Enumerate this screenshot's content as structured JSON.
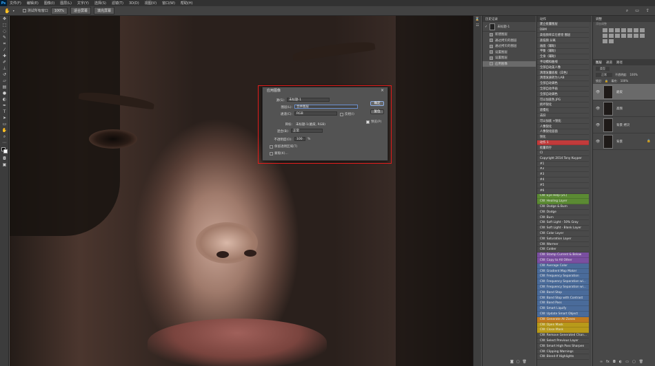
{
  "menubar": {
    "logo": "Ps",
    "items": [
      "文件(F)",
      "编辑(E)",
      "图像(I)",
      "图层(L)",
      "文字(Y)",
      "选择(S)",
      "滤镜(T)",
      "3D(D)",
      "视图(V)",
      "窗口(W)",
      "帮助(H)"
    ]
  },
  "options": {
    "sample_all": "测试所有窗口",
    "zoom": "100%",
    "fit_screen": "适合屏幕",
    "fill_screen": "填充屏幕"
  },
  "dialog": {
    "title": "应用图像",
    "source_label": "源(S):",
    "source_value": "未标题-1",
    "layer_label": "图层(L):",
    "layer_value": "合并图层",
    "channel_label": "通道(C):",
    "channel_value": "RGB",
    "invert_label": "反相(I)",
    "target_label": "目标:",
    "target_value": "未标题-1(磨皮, RGB)",
    "blend_label": "混合(B):",
    "blend_value": "正常",
    "opacity_label": "不透明度(O):",
    "opacity_value": "100",
    "opacity_unit": "%",
    "preserve_label": "保留透明区域(T)",
    "mask_label": "蒙版(K)...",
    "ok": "确定",
    "reset": "复位",
    "preview": "预览(P)"
  },
  "history": {
    "title": "历史记录",
    "snapshot": "未标题-1",
    "items": [
      "新建图层",
      "通过拷贝的图层",
      "通过拷贝的图层",
      "设置图层",
      "设置图层",
      "应用图像"
    ]
  },
  "actions": {
    "title": "动作",
    "items": [
      {
        "label": "建立批量图层",
        "color": "#4a4a4a"
      },
      {
        "label": "DBM",
        "color": "#4a4a4a"
      },
      {
        "label": "高低频率实在感觉 图层",
        "color": "#4a4a4a"
      },
      {
        "label": "高低频 分离",
        "color": "#4a4a4a"
      },
      {
        "label": "画面（辅助）",
        "color": "#4a4a4a"
      },
      {
        "label": "平衡（辅助）",
        "color": "#4a4a4a"
      },
      {
        "label": "全身（辅助）",
        "color": "#4a4a4a"
      },
      {
        "label": "手动模拟曲线",
        "color": "#4a4a4a"
      },
      {
        "label": "全部自动美人像",
        "color": "#4a4a4a"
      },
      {
        "label": "清理发量底板（白色）",
        "color": "#4a4a4a"
      },
      {
        "label": "清理发质转为 LAB",
        "color": "#4a4a4a"
      },
      {
        "label": "全部自动调色",
        "color": "#4a4a4a"
      },
      {
        "label": "全部自动手画",
        "color": "#4a4a4a"
      },
      {
        "label": "全部自动调色",
        "color": "#4a4a4a"
      },
      {
        "label": "可以加底色 JPG",
        "color": "#4a4a4a"
      },
      {
        "label": "损坏锐化",
        "color": "#4a4a4a"
      },
      {
        "label": "遮慢化",
        "color": "#4a4a4a"
      },
      {
        "label": "去旧",
        "color": "#4a4a4a"
      },
      {
        "label": "可以加底 +锐化",
        "color": "#4a4a4a"
      },
      {
        "label": "人像锐化",
        "color": "#4a4a4a"
      },
      {
        "label": "人像锐化层面",
        "color": "#4a4a4a"
      },
      {
        "label": "锐化",
        "color": "#4a4a4a"
      },
      {
        "label": "动作 1",
        "color": "#c23b3b"
      },
      {
        "label": "批量转存",
        "color": "#4a4a4a"
      },
      {
        "label": "CI",
        "color": "#4a4a4a"
      },
      {
        "label": "Copyright 2014 Tony Kuyper",
        "color": "#4a4a4a"
      },
      {
        "label": "#1",
        "color": "#4a4a4a"
      },
      {
        "label": "#2",
        "color": "#4a4a4a"
      },
      {
        "label": "#3",
        "color": "#4a4a4a"
      },
      {
        "label": "#4",
        "color": "#4a4a4a"
      },
      {
        "label": "#5",
        "color": "#4a4a4a"
      },
      {
        "label": "#6",
        "color": "#4a4a4a"
      },
      {
        "label": "CW: Eye Help (2C)",
        "color": "#5b8a33"
      },
      {
        "label": "CW: Healing Layer",
        "color": "#5b8a33"
      },
      {
        "label": "CW: Dodge & Burn",
        "color": "#4a4a4a"
      },
      {
        "label": "CW: Dodge",
        "color": "#4a4a4a"
      },
      {
        "label": "CW: Burn",
        "color": "#4a4a4a"
      },
      {
        "label": "CW: Soft Light - 50% Gray",
        "color": "#4a4a4a"
      },
      {
        "label": "CW: Soft Light - Blank Layer",
        "color": "#4a4a4a"
      },
      {
        "label": "CW: Color Layer",
        "color": "#4a4a4a"
      },
      {
        "label": "CW: Saturation Layer",
        "color": "#4a4a4a"
      },
      {
        "label": "CW: Warmer",
        "color": "#4a4a4a"
      },
      {
        "label": "CW: Colder",
        "color": "#4a4a4a"
      },
      {
        "label": "CW: Stamp Current & Below",
        "color": "#7a4fa0"
      },
      {
        "label": "CW: Copy to All Other",
        "color": "#7a4fa0"
      },
      {
        "label": "CW: Average Color",
        "color": "#4a6b9a"
      },
      {
        "label": "CW: Gradient Map Maker",
        "color": "#4a6b9a"
      },
      {
        "label": "CW: Frequency Separation",
        "color": "#4a6b9a"
      },
      {
        "label": "CW: Frequency Separation wi...",
        "color": "#4a6b9a"
      },
      {
        "label": "CW: Frequency Separation wi...",
        "color": "#4a6b9a"
      },
      {
        "label": "CW: Band Stop",
        "color": "#4a6b9a"
      },
      {
        "label": "CW: Band Stop with Contrast",
        "color": "#4a6b9a"
      },
      {
        "label": "CW: Band Pass",
        "color": "#4a6b9a"
      },
      {
        "label": "CW: Smart Liquify",
        "color": "#4a6b9a"
      },
      {
        "label": "CW: Update Smart Object",
        "color": "#4a6b9a"
      },
      {
        "label": "CW: Generate All Zones",
        "color": "#c07a1f"
      },
      {
        "label": "CW: Open Mask",
        "color": "#b89a1a"
      },
      {
        "label": "CW: Close Mask",
        "color": "#b89a1a"
      },
      {
        "label": "CW: Remove Generated Chan...",
        "color": "#4a4a4a"
      },
      {
        "label": "CW: Select Previous Layer",
        "color": "#4a4a4a"
      },
      {
        "label": "CW: Smart High Pass Sharpen",
        "color": "#4a4a4a"
      },
      {
        "label": "CW: Clipping Warnings",
        "color": "#4a4a4a"
      },
      {
        "label": "CW: Blend-If Highlights",
        "color": "#4a4a4a"
      }
    ]
  },
  "adjustments": {
    "title": "调整",
    "subtitle": "添加调整"
  },
  "layers_panel": {
    "tabs": [
      "图层",
      "通道",
      "路径"
    ],
    "kind": "类型",
    "blend": "正常",
    "opacity_label": "不透明度:",
    "opacity": "100%",
    "lock_label": "锁定:",
    "fill_label": "填充:",
    "fill": "100%",
    "layers": [
      "磨皮",
      "高频",
      "背景 拷贝",
      "背景"
    ]
  }
}
